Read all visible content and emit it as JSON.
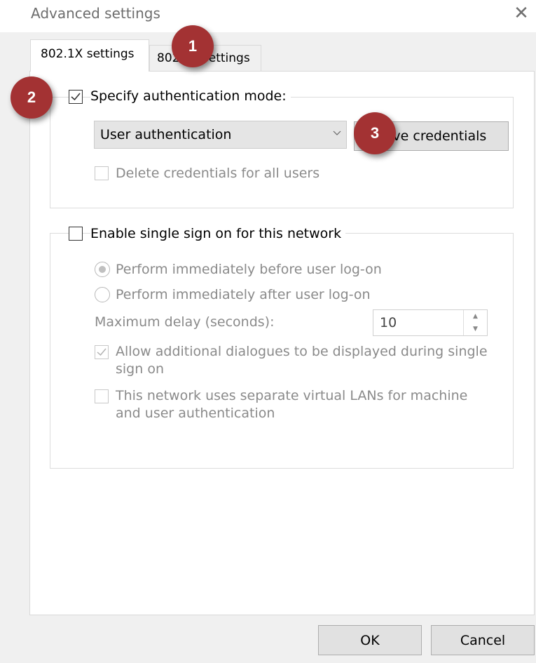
{
  "window": {
    "title": "Advanced settings",
    "close_glyph": "✕"
  },
  "tabs": [
    {
      "label": "802.1X settings",
      "active": true
    },
    {
      "label": "802.11 settings",
      "active": false
    }
  ],
  "auth_group": {
    "specify_label": "Specify authentication mode:",
    "specify_checked": true,
    "mode_selected": "User authentication",
    "save_button": "Save credentials",
    "delete_label": "Delete credentials for all users",
    "delete_checked": false
  },
  "sso_group": {
    "enable_label": "Enable single sign on for this network",
    "enable_checked": false,
    "before_label": "Perform immediately before user log-on",
    "after_label": "Perform immediately after user log-on",
    "delay_label": "Maximum delay (seconds):",
    "delay_value": "10",
    "allow_label_line1": "Allow additional dialogues to be displayed during single",
    "allow_label_line2": "sign on",
    "allow_checked": true,
    "vlan_label_line1": "This network uses separate virtual LANs for machine",
    "vlan_label_line2": "and user authentication",
    "vlan_checked": false
  },
  "footer": {
    "ok": "OK",
    "cancel": "Cancel"
  },
  "badges": [
    "1",
    "2",
    "3"
  ],
  "colors": {
    "badge": "#a33233",
    "accent_check": "#333333"
  }
}
